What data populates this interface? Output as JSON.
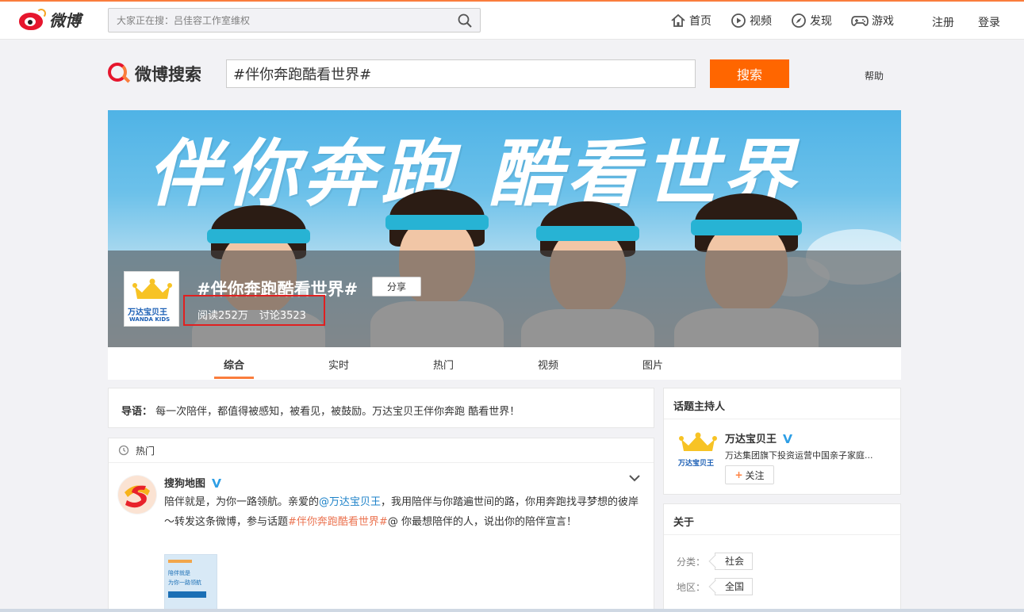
{
  "topbar": {
    "logo_text": "微博",
    "search_placeholder": "大家正在搜：吕佳容工作室维权",
    "nav": [
      {
        "label": "首页",
        "icon": "home-icon"
      },
      {
        "label": "视频",
        "icon": "video-icon"
      },
      {
        "label": "发现",
        "icon": "compass-icon"
      },
      {
        "label": "游戏",
        "icon": "gamepad-icon"
      }
    ],
    "register": "注册",
    "login": "登录"
  },
  "search_header": {
    "logo_text": "微博搜索",
    "query": "#伴你奔跑酷看世界#",
    "button": "搜索",
    "help": "帮助"
  },
  "banner": {
    "art_title": "伴你奔跑 酷看世界",
    "topic_title": "#伴你奔跑酷看世界#",
    "share": "分享",
    "reads": "阅读252万",
    "discussions": "讨论3523",
    "brand_avatar_cn": "万达宝贝王",
    "brand_avatar_en": "WANDA KIDS"
  },
  "tabs": [
    {
      "label": "综合",
      "active": true
    },
    {
      "label": "实时",
      "active": false
    },
    {
      "label": "热门",
      "active": false
    },
    {
      "label": "视频",
      "active": false
    },
    {
      "label": "图片",
      "active": false
    }
  ],
  "lead": {
    "label": "导语：",
    "text": "每一次陪伴，都值得被感知，被看见，被鼓励。万达宝贝王伴你奔跑 酷看世界！"
  },
  "feed": {
    "section": "热门",
    "post": {
      "author": "搜狗地图",
      "text_1": "陪伴就是，为你一路领航。亲爱的",
      "mention_1": "@万达宝贝王",
      "text_2": "，我用陪伴与你踏遍世间的路，你用奔跑找寻梦想的彼岸～转发这条微博，参与话题",
      "hashtag": "#伴你奔跑酷看世界#",
      "text_3": "@ 你最想陪伴的人，说出你的陪伴宣言！",
      "thumb_line1": "陪伴就是",
      "thumb_line2": "为你一路领航"
    }
  },
  "host_card": {
    "title": "话题主持人",
    "name": "万达宝贝王",
    "desc": "万达集团旗下投资运营中国亲子家庭...",
    "follow": "关注",
    "avatar_text": "万达宝贝王"
  },
  "about_card": {
    "title": "关于",
    "category_label": "分类：",
    "category": "社会",
    "region_label": "地区：",
    "region": "全国"
  },
  "colors": {
    "accent": "#ff6600",
    "weibo_red": "#e6162d",
    "verified_blue": "#2d9ee5",
    "highlight_box": "#e02020"
  }
}
